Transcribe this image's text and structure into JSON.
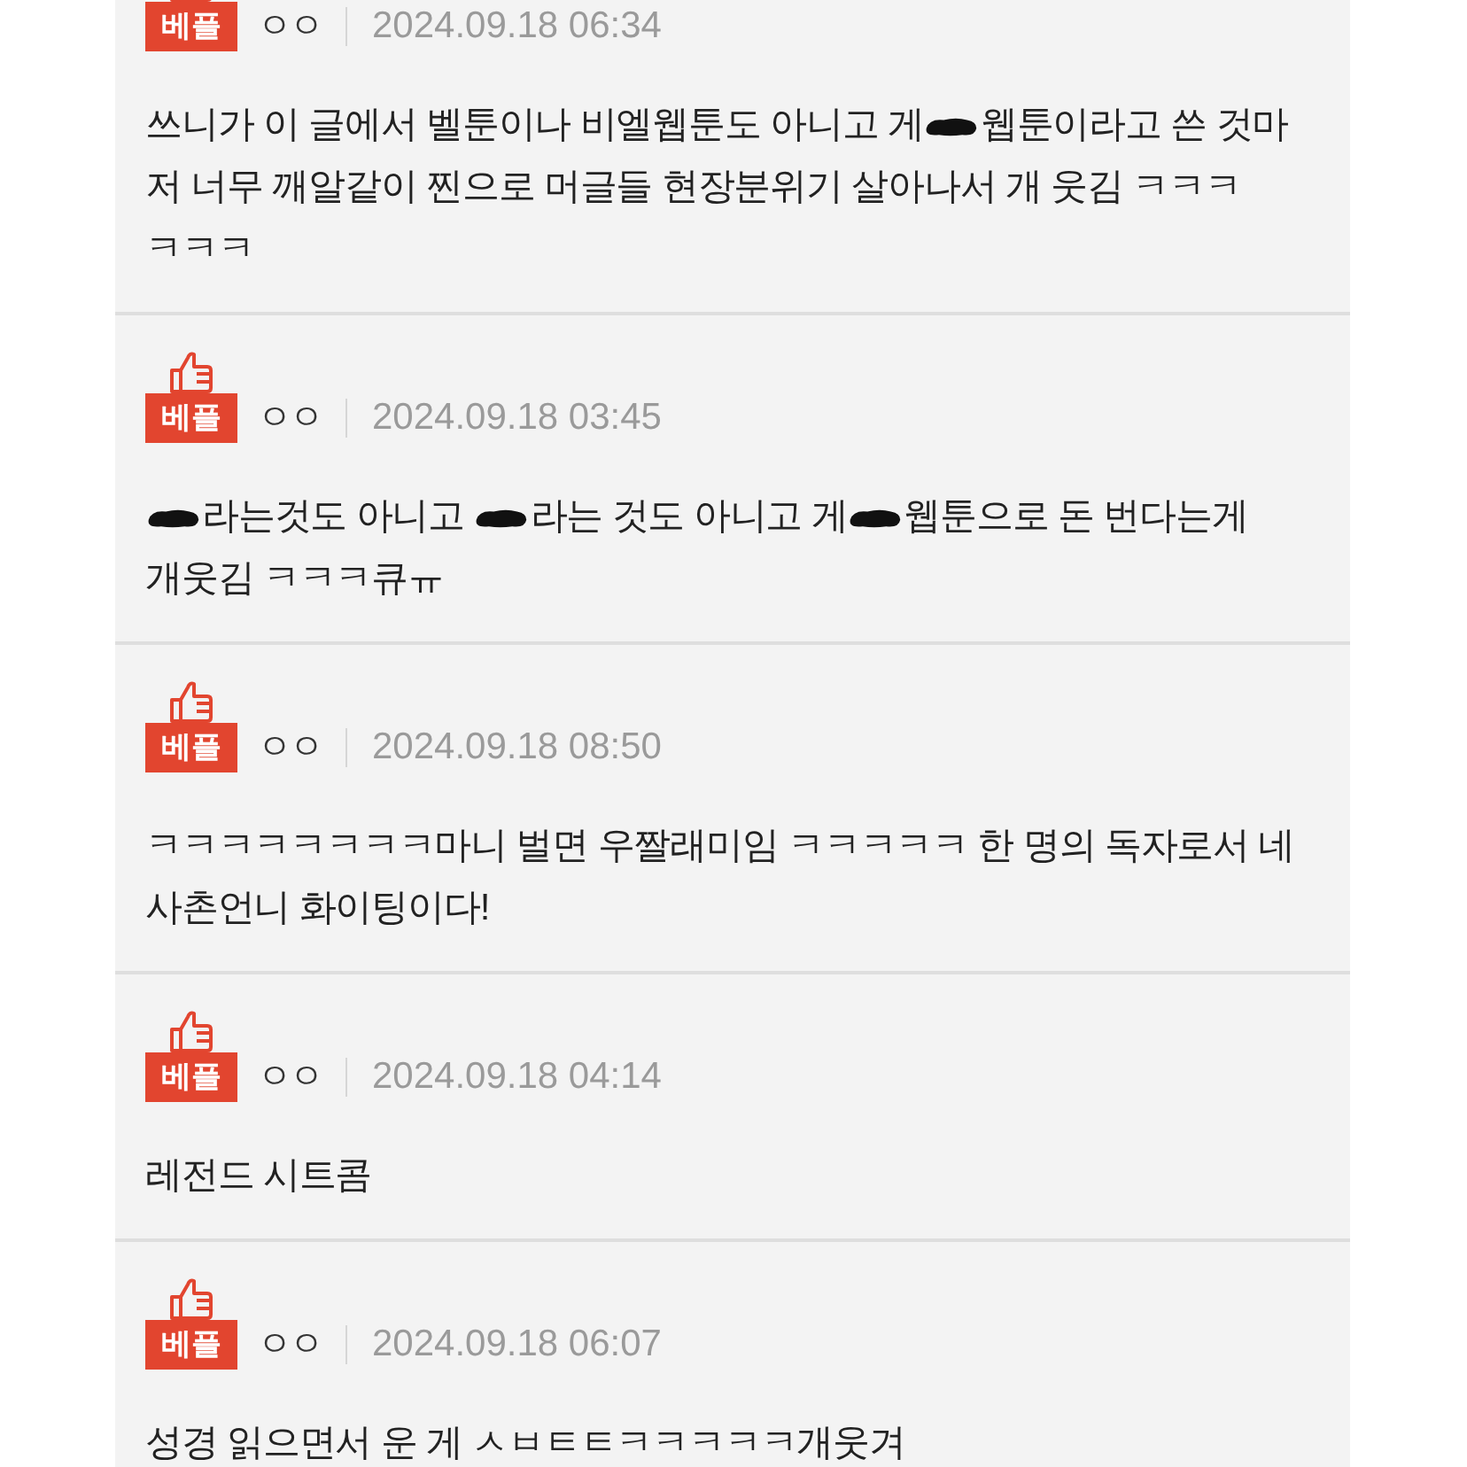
{
  "comments": [
    {
      "badge": "베플",
      "author": "ㅇㅇ",
      "date": "2024.09.18 06:34",
      "lines": [
        [
          {
            "kind": "text",
            "text": "쓰니가 이 글에서 벨툰이나 비엘웹툰도 아니고 게"
          },
          {
            "kind": "scribble"
          },
          {
            "kind": "text",
            "text": "웹툰이라고 쓴 것마"
          }
        ],
        [
          {
            "kind": "text",
            "text": "저 너무 깨알같이 찐으로 머글들 현장분위기 살아나서 개 웃김 ㅋㅋㅋ"
          }
        ],
        [
          {
            "kind": "text",
            "text": "ㅋㅋㅋ"
          }
        ]
      ]
    },
    {
      "badge": "베플",
      "author": "ㅇㅇ",
      "date": "2024.09.18 03:45",
      "lines": [
        [
          {
            "kind": "scribble"
          },
          {
            "kind": "text",
            "text": "라는것도 아니고 "
          },
          {
            "kind": "scribble"
          },
          {
            "kind": "text",
            "text": "라는 것도 아니고 게"
          },
          {
            "kind": "scribble"
          },
          {
            "kind": "text",
            "text": "웹툰으로 돈 번다는게"
          }
        ],
        [
          {
            "kind": "text",
            "text": "개웃김 ㅋㅋㅋ큐ㅠ"
          }
        ]
      ]
    },
    {
      "badge": "베플",
      "author": "ㅇㅇ",
      "date": "2024.09.18 08:50",
      "lines": [
        [
          {
            "kind": "text",
            "text": "ㅋㅋㅋㅋㅋㅋㅋㅋ마니 벌면 우짤래미임 ㅋㅋㅋㅋㅋ 한 명의 독자로서 네"
          }
        ],
        [
          {
            "kind": "text",
            "text": "사촌언니 화이팅이다!"
          }
        ]
      ]
    },
    {
      "badge": "베플",
      "author": "ㅇㅇ",
      "date": "2024.09.18 04:14",
      "lines": [
        [
          {
            "kind": "text",
            "text": "레전드 시트콤"
          }
        ]
      ]
    },
    {
      "badge": "베플",
      "author": "ㅇㅇ",
      "date": "2024.09.18 06:07",
      "lines": [
        [
          {
            "kind": "text",
            "text": "성경 읽으면서 운 게 ㅅㅂㅌㅌㅋㅋㅋㅋㅋ개웃겨"
          }
        ]
      ]
    }
  ]
}
